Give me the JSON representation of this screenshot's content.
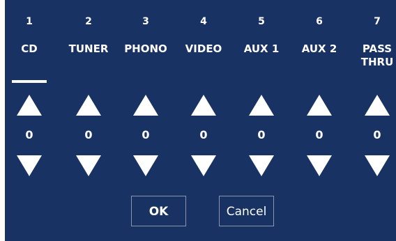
{
  "inputs": [
    {
      "number": "1",
      "name": "CD",
      "level": "0",
      "selected": true
    },
    {
      "number": "2",
      "name": "TUNER",
      "level": "0",
      "selected": false
    },
    {
      "number": "3",
      "name": "PHONO",
      "level": "0",
      "selected": false
    },
    {
      "number": "4",
      "name": "VIDEO",
      "level": "0",
      "selected": false
    },
    {
      "number": "5",
      "name": "AUX 1",
      "level": "0",
      "selected": false
    },
    {
      "number": "6",
      "name": "AUX 2",
      "level": "0",
      "selected": false
    },
    {
      "number": "7",
      "name": "PASS\nTHRU",
      "level": "0",
      "selected": false
    }
  ],
  "buttons": {
    "ok_label": "OK",
    "cancel_label": "Cancel"
  },
  "colors": {
    "background": "#183263",
    "foreground": "#ffffff"
  }
}
